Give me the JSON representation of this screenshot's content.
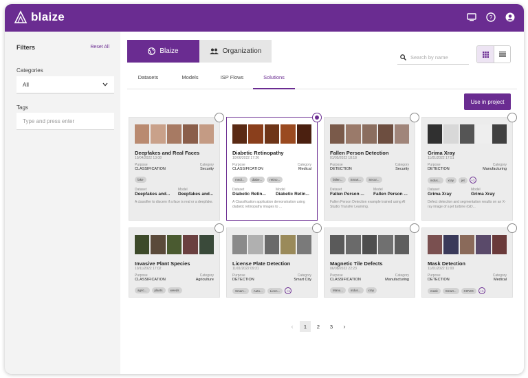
{
  "brand": {
    "name": "blaize",
    "color": "#6a2c91"
  },
  "topbar": {
    "icons": [
      "display-icon",
      "help-circle-icon",
      "account-circle-icon"
    ]
  },
  "sidebar": {
    "title": "Filters",
    "reset_label": "Reset All",
    "categories_label": "Categories",
    "categories_value": "All",
    "tags_label": "Tags",
    "tags_placeholder": "Type and press enter"
  },
  "scope_tabs": [
    {
      "label": "Blaize",
      "icon": "globe-icon",
      "active": true
    },
    {
      "label": "Organization",
      "icon": "people-icon",
      "active": false
    }
  ],
  "search": {
    "placeholder": "Search by name"
  },
  "nav_tabs": [
    {
      "label": "Datasets",
      "active": false
    },
    {
      "label": "Models",
      "active": false
    },
    {
      "label": "ISP Flows",
      "active": false
    },
    {
      "label": "Solutions",
      "active": true
    }
  ],
  "use_button": "Use in project",
  "cards": [
    {
      "title": "Deepfakes and Real Faces",
      "date": "10/04/2022 13:08",
      "purpose_label": "Purpose",
      "purpose": "CLASSIFICATION",
      "category_label": "Category",
      "category": "Security",
      "chips": [
        "fake"
      ],
      "more": "",
      "dataset_label": "Dataset",
      "dataset": "Deepfakes and...",
      "model_label": "Model",
      "model": "Deepfakes and...",
      "description": "A classifier to discern if a face is real or a deepfake.",
      "thumbs": [
        "#b98a70",
        "#c9a18a",
        "#a77a63",
        "#8a5e4a",
        "#c49b84"
      ],
      "selected": false
    },
    {
      "title": "Diabetic Retinopathy",
      "date": "10/06/2022 17:26",
      "purpose_label": "Purpose",
      "purpose": "CLASSIFICATION",
      "category_label": "Category",
      "category": "Medical",
      "chips": [
        "medi...",
        "diabe...",
        "retino..."
      ],
      "more": "",
      "dataset_label": "Dataset",
      "dataset": "Diabetic Retin...",
      "model_label": "Model",
      "model": "Diabetic Retin...",
      "description": "A Classification application demonstration using diabetic retinopathy images to ...",
      "thumbs": [
        "#5a2a14",
        "#8a3f1c",
        "#6e3518",
        "#9a4a20",
        "#4b2010"
      ],
      "selected": true
    },
    {
      "title": "Fallen Person Detection",
      "date": "01/05/2022 18:18",
      "purpose_label": "Purpose",
      "purpose": "DETECTION",
      "category_label": "Category",
      "category": "Security",
      "chips": [
        "fallen...",
        "Smart...",
        "Secur..."
      ],
      "more": "",
      "dataset_label": "Dataset",
      "dataset": "Fallen Person ...",
      "model_label": "Model",
      "model": "Fallen Person ...",
      "description": "Fallen Person Detection example trained using AI Studio Transfer Learning.",
      "thumbs": [
        "#7a5a4a",
        "#9a7a6a",
        "#8b6e5f",
        "#6d4e40",
        "#a0857a"
      ],
      "selected": false
    },
    {
      "title": "Grima Xray",
      "date": "11/01/2022 17:51",
      "purpose_label": "Purpose",
      "purpose": "DETECTION",
      "category_label": "Category",
      "category": "Manufacturing",
      "chips": [
        "indus...",
        "xray",
        "jet"
      ],
      "more": "+1",
      "dataset_label": "Dataset",
      "dataset": "Grima Xray",
      "model_label": "Model",
      "model": "Grima Xray",
      "description": "Defect detection and segmentation results on an X-ray image of a jet turbine (GD...",
      "thumbs": [
        "#303030",
        "#d8d8d8",
        "#555555",
        "#eeeeee",
        "#404040"
      ],
      "selected": false
    },
    {
      "title": "Invasive Plant Species",
      "date": "10/11/2022 17:02",
      "purpose_label": "Purpose",
      "purpose": "CLASSIFICATION",
      "category_label": "Category",
      "category": "Agriculture",
      "chips": [
        "agric...",
        "plants",
        "weeds"
      ],
      "more": "",
      "dataset_label": "",
      "dataset": "",
      "model_label": "",
      "model": "",
      "description": "",
      "thumbs": [
        "#3d4a2a",
        "#5a4a3a",
        "#4a5a30",
        "#6a4040",
        "#3a4a3a"
      ],
      "selected": false
    },
    {
      "title": "License Plate Detection",
      "date": "11/01/2022 09:31",
      "purpose_label": "Purpose",
      "purpose": "DETECTION",
      "category_label": "Category",
      "category": "Smart City",
      "chips": [
        "Smart...",
        "Auto...",
        "Licen..."
      ],
      "more": "+1",
      "dataset_label": "",
      "dataset": "",
      "model_label": "",
      "model": "",
      "description": "",
      "thumbs": [
        "#8a8a8a",
        "#b0b0b0",
        "#6a6a6a",
        "#9a8a5a",
        "#7a7a7a"
      ],
      "selected": false
    },
    {
      "title": "Magnetic Tile Defects",
      "date": "06/08/2022 22:23",
      "purpose_label": "Purpose",
      "purpose": "CLASSIFICATION",
      "category_label": "Category",
      "category": "Manufacturing",
      "chips": [
        "Manu...",
        "indus...",
        "xray"
      ],
      "more": "",
      "dataset_label": "",
      "dataset": "",
      "model_label": "",
      "model": "",
      "description": "",
      "thumbs": [
        "#5a5a5a",
        "#6a6a6a",
        "#4e4e4e",
        "#707070",
        "#5e5e5e"
      ],
      "selected": false
    },
    {
      "title": "Mask Detection",
      "date": "11/01/2022 11:00",
      "purpose_label": "Purpose",
      "purpose": "DETECTION",
      "category_label": "Category",
      "category": "Medical",
      "chips": [
        "mask",
        "Smart...",
        "COVID"
      ],
      "more": "+1",
      "dataset_label": "",
      "dataset": "",
      "model_label": "",
      "model": "",
      "description": "",
      "thumbs": [
        "#7a5050",
        "#3a3a5a",
        "#8a6a5a",
        "#5a4a6a",
        "#6a3a3a"
      ],
      "selected": false
    }
  ],
  "pagination": {
    "pages": [
      "1",
      "2",
      "3"
    ],
    "current": "1",
    "prev": "‹",
    "next": "›"
  }
}
